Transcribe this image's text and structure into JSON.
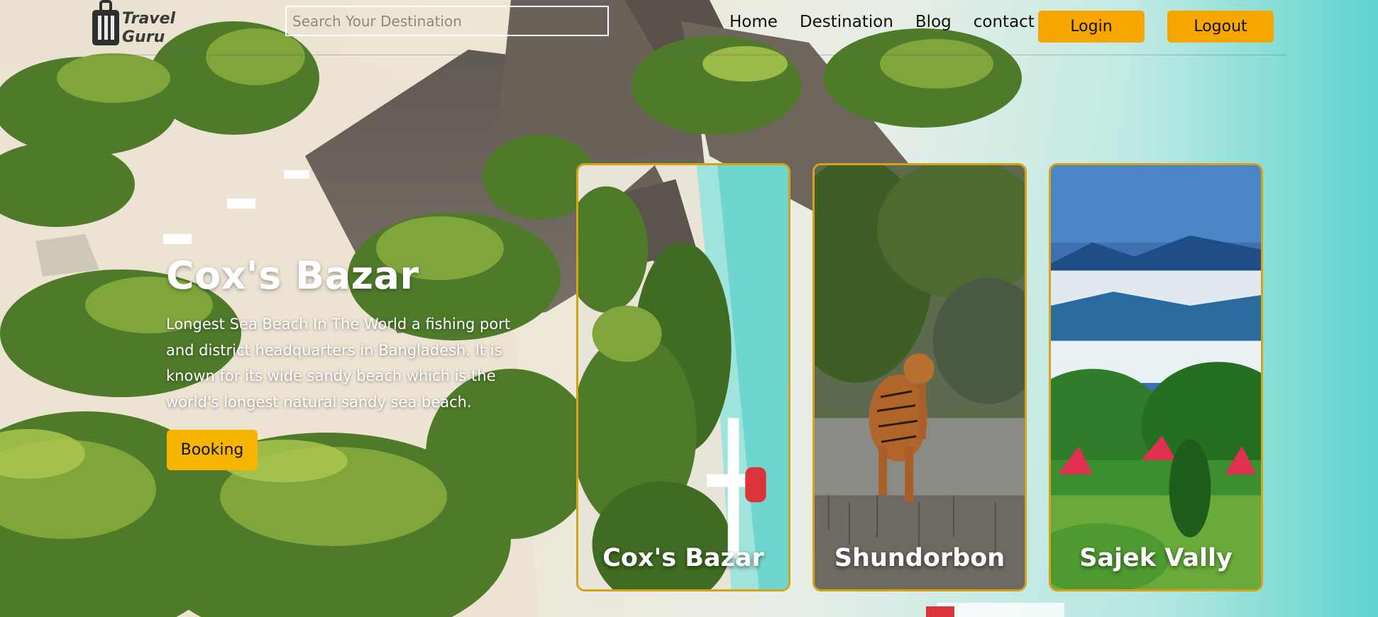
{
  "header": {
    "logo_lines": [
      "Travel",
      "Guru"
    ],
    "search_placeholder": "Search Your Destination",
    "nav": [
      "Home",
      "Destination",
      "Blog",
      "contact"
    ],
    "login_label": "Login",
    "logout_label": "Logout"
  },
  "hero": {
    "title": "Cox's Bazar",
    "description": "Longest Sea Beach In The World a fishing port and district headquarters in Bangladesh. It is known for its wide sandy beach which is the world's longest natural sandy sea beach.",
    "booking_label": "Booking"
  },
  "cards": [
    {
      "label": "Cox's Bazar"
    },
    {
      "label": "Shundorbon"
    },
    {
      "label": "Sajek Vally"
    }
  ],
  "colors": {
    "accent": "#f7a600",
    "card_border": "#d9a11a"
  },
  "icons": {
    "logo": "suitcase-icon"
  }
}
